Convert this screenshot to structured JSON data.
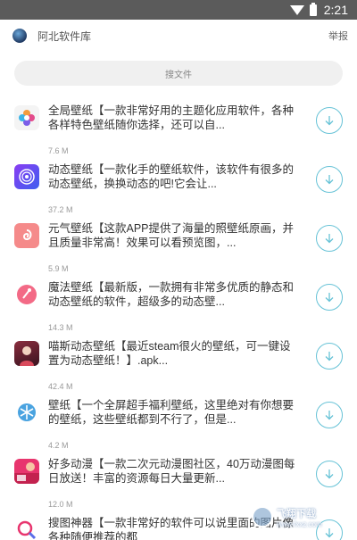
{
  "status_bar": {
    "time": "2:21"
  },
  "header": {
    "app_name": "阿北软件库",
    "report_label": "举报"
  },
  "search": {
    "placeholder": "搜文件"
  },
  "items": [
    {
      "desc": "全局壁纸【一款非常好用的主题化应用软件，各种各样特色壁纸随你选择，还可以自...",
      "size": "7.6 M",
      "icon": "flower-icon",
      "color": "#f2f2f2"
    },
    {
      "desc": "动态壁纸【一款化手的壁纸软件，该软件有很多的动态壁纸，换换动态的吧!它会让...",
      "size": "37.2 M",
      "icon": "vortex-icon",
      "color": "#6b3cf0"
    },
    {
      "desc": "元气壁纸【这款APP提供了海量的照壁纸原画，并且质量非常高！效果可以看预览图，...",
      "size": "5.9 M",
      "icon": "swirl-icon",
      "color": "#f06b6b"
    },
    {
      "desc": "魔法壁纸【最新版，一款拥有非常多优质的静态和动态壁纸的软件，超级多的动态壁...",
      "size": "14.3 M",
      "icon": "magic-icon",
      "color": "#ffffff"
    },
    {
      "desc": "喵斯动态壁纸【最近steam很火的壁纸，可一键设置为动态壁纸！】.apk...",
      "size": "42.4 M",
      "icon": "character-icon",
      "color": "#5a1e2e"
    },
    {
      "desc": "壁纸【一个全屏超手福利壁纸，这里绝对有你想要的壁纸，这些壁纸都到不行了，但是...",
      "size": "4.2 M",
      "icon": "snowflake-icon",
      "color": "#ffffff"
    },
    {
      "desc": "好多动漫【一款二次元动漫图社区，40万动漫图每日放送！丰富的资源每日大量更新...",
      "size": "12.0 M",
      "icon": "anime-icon",
      "color": "#e8356e"
    },
    {
      "desc": "搜图神器【一款非常好的软件可以说里面的图片像各种随便推荐的都",
      "size": "",
      "icon": "search-app-icon",
      "color": "#ffffff"
    }
  ],
  "watermark": {
    "title": "飞翔下载",
    "url": "www.fxxz.com"
  }
}
